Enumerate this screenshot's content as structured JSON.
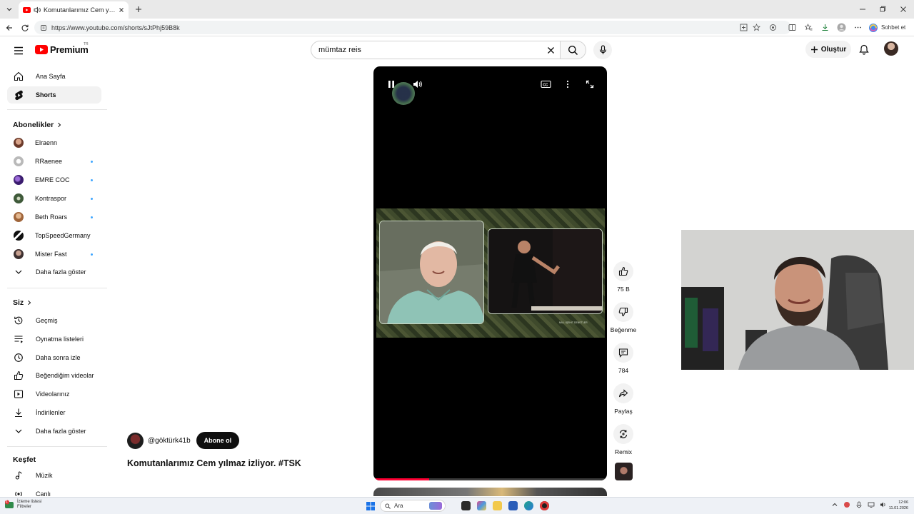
{
  "browser": {
    "tab_title": "Komutanlarımız Cem yılmaz iz",
    "url": "https://www.youtube.com/shorts/sJtPhj59B8k",
    "copilot_label": "Sohbet et"
  },
  "masthead": {
    "logo_text": "Premium",
    "logo_region": "TR",
    "search_value": "mümtaz reis",
    "create_label": "Oluştur"
  },
  "sidebar": {
    "main": [
      {
        "label": "Ana Sayfa",
        "icon": "home-icon"
      },
      {
        "label": "Shorts",
        "icon": "shorts-icon",
        "active": true
      }
    ],
    "subscriptions_title": "Abonelikler",
    "subscriptions": [
      {
        "label": "Elraenn",
        "new": false,
        "color": "#8a5a45"
      },
      {
        "label": "RRaenee",
        "new": true,
        "color": "#b9b9b9"
      },
      {
        "label": "EMRE COC",
        "new": true,
        "color": "#4b2a8a"
      },
      {
        "label": "Kontraspor",
        "new": true,
        "color": "#3f5a3a"
      },
      {
        "label": "Beth Roars",
        "new": true,
        "color": "#b77a4a"
      },
      {
        "label": "TopSpeedGermany",
        "new": false,
        "color": "#111111"
      },
      {
        "label": "Mister Fast",
        "new": true,
        "color": "#5a4a4a"
      }
    ],
    "show_more_1": "Daha fazla göster",
    "you_title": "Siz",
    "you": [
      {
        "label": "Geçmiş",
        "icon": "history-icon"
      },
      {
        "label": "Oynatma listeleri",
        "icon": "playlists-icon"
      },
      {
        "label": "Daha sonra izle",
        "icon": "watch-later-icon"
      },
      {
        "label": "Beğendiğim videolar",
        "icon": "liked-icon"
      },
      {
        "label": "Videolarınız",
        "icon": "your-videos-icon"
      },
      {
        "label": "İndirilenler",
        "icon": "downloads-icon"
      }
    ],
    "show_more_2": "Daha fazla göster",
    "explore_title": "Keşfet",
    "explore": [
      {
        "label": "Müzik",
        "icon": "music-icon"
      },
      {
        "label": "Canlı",
        "icon": "live-icon"
      }
    ]
  },
  "short": {
    "channel_handle": "@göktürk41b",
    "subscribe_label": "Abone ol",
    "title": "Komutanlarımız Cem yılmaz izliyor. #TSK",
    "progress": 0.24,
    "overlay_caption": "MİLLİ ŞEHİT DENETLER"
  },
  "actions": {
    "like_count": "75 B",
    "dislike_label": "Beğenme",
    "comment_count": "784",
    "share_label": "Paylaş",
    "remix_label": "Remix"
  },
  "taskbar": {
    "notif_title": "İzleme listesi",
    "notif_sub": "Filtreler",
    "notif_badge": "1",
    "search_placeholder": "Ara",
    "time": "12:06",
    "date": "11.01.2026"
  }
}
